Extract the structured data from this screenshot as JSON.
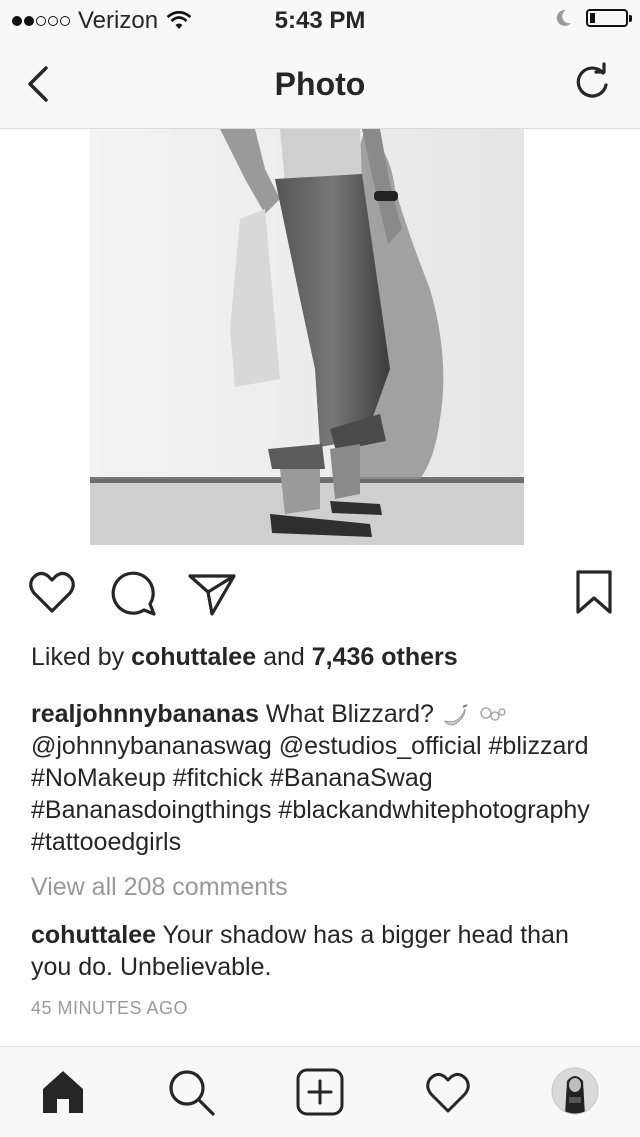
{
  "status_bar": {
    "carrier": "Verizon",
    "time": "5:43 PM",
    "signal_bars_filled": 2,
    "signal_bars_total": 5,
    "battery_level": 0.15
  },
  "nav": {
    "title": "Photo",
    "back_icon": "chevron-left-icon",
    "refresh_icon": "refresh-icon"
  },
  "post": {
    "photo_description_icon": "photo",
    "actions": [
      "like-icon",
      "comment-icon",
      "share-icon",
      "bookmark-icon"
    ],
    "likes": {
      "prefix": "Liked by",
      "user": "cohuttalee",
      "and": "and",
      "count": "7,436 others"
    },
    "caption": {
      "user": "realjohnnybananas",
      "text_line1": "What Blizzard?",
      "text_rest": "@johnnybananaswag @estudios_official #blizzard #NoMakeup #fitchick #BananaSwag #Bananasdoingthings #blackandwhitephotography #tattooedgirls"
    },
    "view_all": "View all 208 comments",
    "comment": {
      "user": "cohuttalee",
      "text": "Your shadow has a bigger head than you do. Unbelievable."
    },
    "time_ago": "45 MINUTES AGO"
  },
  "tab_bar": {
    "items": [
      "home-icon",
      "search-icon",
      "new-post-icon",
      "activity-icon",
      "profile-avatar"
    ]
  },
  "colors": {
    "text": "#262626",
    "muted": "#999999",
    "bar_bg": "#f8f8f8",
    "divider": "#dbdbdb"
  }
}
